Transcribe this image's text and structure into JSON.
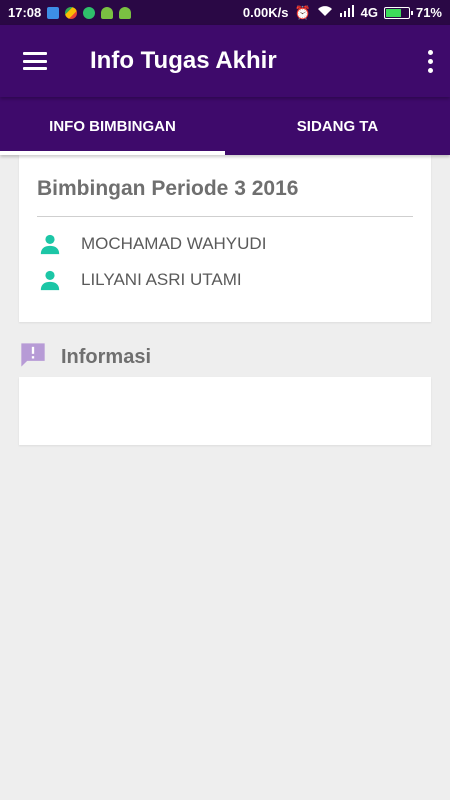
{
  "status_bar": {
    "time": "17:08",
    "net_speed": "0.00K/s",
    "network": "4G",
    "battery": "71%",
    "battery_level": 0.71
  },
  "app_bar": {
    "title": "Info Tugas Akhir",
    "menu_icon": "hamburger-menu-icon",
    "overflow_icon": "more-vert-icon"
  },
  "tabs": [
    {
      "label": "INFO BIMBINGAN",
      "active": true
    },
    {
      "label": "SIDANG TA",
      "active": false
    }
  ],
  "bimbingan": {
    "title": "Bimbingan Periode 3 2016",
    "people": [
      {
        "name": "MOCHAMAD WAHYUDI",
        "icon": "person-icon"
      },
      {
        "name": "LILYANI ASRI UTAMI",
        "icon": "person-icon"
      }
    ]
  },
  "informasi": {
    "title": "Informasi",
    "icon": "announcement-icon",
    "content": ""
  },
  "colors": {
    "primary": "#3e0a6b",
    "status_bar": "#2a0845",
    "accent": "#1cc6a6",
    "info_icon": "#b79bd6",
    "background": "#eeeeee"
  }
}
